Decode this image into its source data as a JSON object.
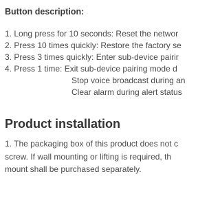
{
  "button_description": {
    "title": "Button description:",
    "lines": [
      "1. Long press for 10 seconds: Reset the networ",
      "2. Press 10 times quickly: Restore the factory se",
      "3. Press 3 times quickly: Enter sub-device pairir",
      "4. Press 1 time: Exit sub-device pairing mode d",
      "Stop voice broadcast during an",
      "Clear alarm during alert status"
    ]
  },
  "product_installation": {
    "title": "Product installation",
    "lines": [
      "1. The packaging box of this product does not c",
      "screw. If wall mounting or lifting is required, th",
      "mount shall be purchased separately."
    ]
  }
}
